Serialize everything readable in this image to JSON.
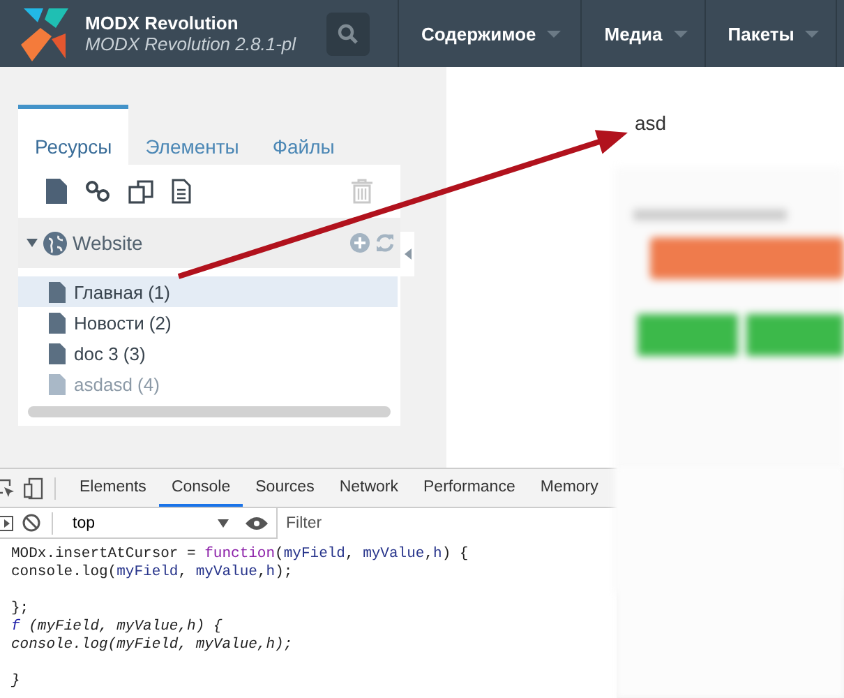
{
  "header": {
    "title": "MODX Revolution",
    "subtitle": "MODX Revolution 2.8.1-pl",
    "menu": [
      {
        "label": "Содержимое"
      },
      {
        "label": "Медиа"
      },
      {
        "label": "Пакеты"
      }
    ]
  },
  "sidebar": {
    "tabs": [
      {
        "label": "Ресурсы",
        "selected": true
      },
      {
        "label": "Элементы",
        "selected": false
      },
      {
        "label": "Файлы",
        "selected": false
      }
    ],
    "context": {
      "label": "Website",
      "expanded": true
    },
    "items": [
      {
        "label": "Главная (1)",
        "selected": true,
        "published": true
      },
      {
        "label": "Новости (2)",
        "selected": false,
        "published": true
      },
      {
        "label": "doc 3 (3)",
        "selected": false,
        "published": true
      },
      {
        "label": "asdasd (4)",
        "selected": false,
        "published": false
      }
    ]
  },
  "content": {
    "text": "asd"
  },
  "devtools": {
    "tabs": [
      {
        "label": "Elements",
        "selected": false
      },
      {
        "label": "Console",
        "selected": true
      },
      {
        "label": "Sources",
        "selected": false
      },
      {
        "label": "Network",
        "selected": false
      },
      {
        "label": "Performance",
        "selected": false
      },
      {
        "label": "Memory",
        "selected": false
      }
    ],
    "context": "top",
    "filter_placeholder": "Filter",
    "messages": [
      {
        "kind": "input",
        "tokens": [
          {
            "text": "MODx.insertAtCursor = ",
            "kind": "plain"
          },
          {
            "text": "function",
            "kind": "keyword"
          },
          {
            "text": "(",
            "kind": "plain"
          },
          {
            "text": "myField",
            "kind": "param"
          },
          {
            "text": ", ",
            "kind": "plain"
          },
          {
            "text": "myValue",
            "kind": "param"
          },
          {
            "text": ",",
            "kind": "plain"
          },
          {
            "text": "h",
            "kind": "param"
          },
          {
            "text": ") {\nconsole.log(",
            "kind": "plain"
          },
          {
            "text": "myField",
            "kind": "param"
          },
          {
            "text": ", ",
            "kind": "plain"
          },
          {
            "text": "myValue",
            "kind": "param"
          },
          {
            "text": ",",
            "kind": "plain"
          },
          {
            "text": "h",
            "kind": "param"
          },
          {
            "text": ");\n\n};",
            "kind": "plain"
          }
        ]
      },
      {
        "kind": "output",
        "tokens": [
          {
            "text": "f",
            "kind": "keyword"
          },
          {
            "text": " (myField, myValue,h) {\nconsole.log(myField, myValue,h);\n\n}",
            "kind": "plain"
          }
        ]
      }
    ]
  }
}
